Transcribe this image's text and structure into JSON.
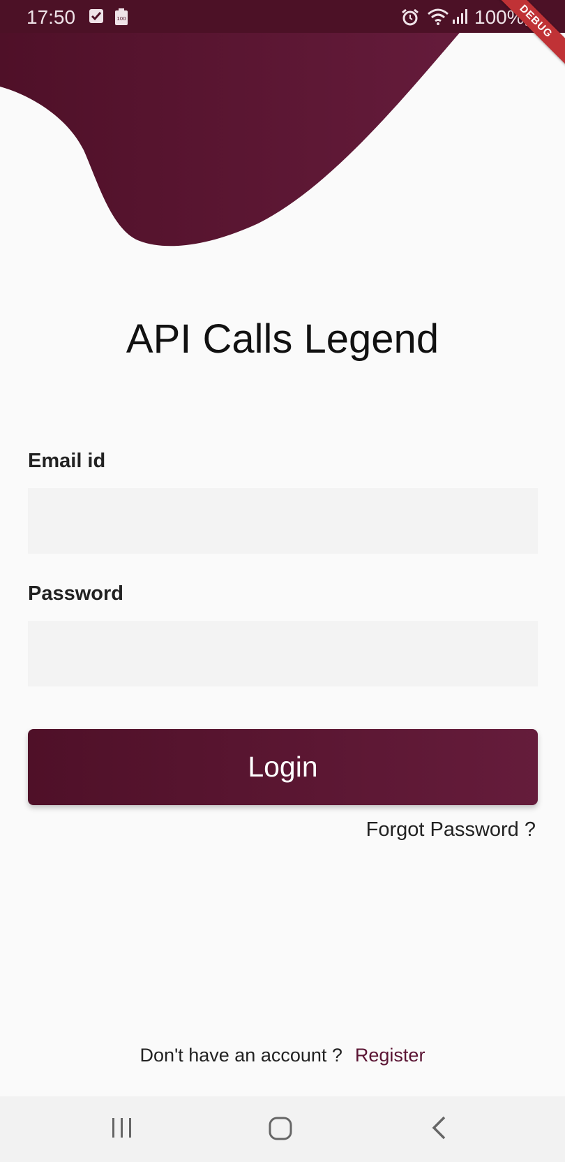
{
  "status_bar": {
    "time": "17:50",
    "battery": "100%",
    "icons": [
      "checkbox-icon",
      "battery-saver-icon",
      "alarm-icon",
      "wifi-icon",
      "signal-icon",
      "battery-icon"
    ]
  },
  "debug_banner": "DEBUG",
  "app_title": "API Calls Legend",
  "form": {
    "email_label": "Email id",
    "email_value": "",
    "password_label": "Password",
    "password_value": "",
    "login_label": "Login",
    "forgot_label": "Forgot Password ?"
  },
  "footer": {
    "prompt": "Don't have an account ?",
    "register_label": "Register"
  },
  "nav_bar": {
    "icons": [
      "recent-apps-icon",
      "home-icon",
      "back-icon"
    ]
  },
  "colors": {
    "primary": "#5a1433",
    "primary_dark": "#4c1126",
    "background": "#fafafa",
    "input_fill": "#f3f3f3",
    "debug_ribbon": "#c03236"
  }
}
